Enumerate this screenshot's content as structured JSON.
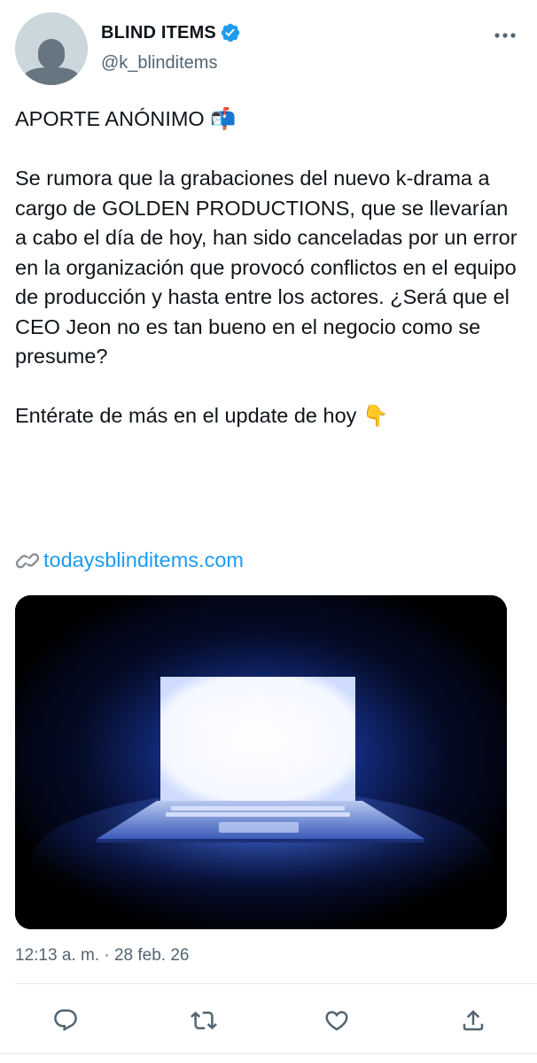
{
  "author": {
    "display_name": "BLIND ITEMS",
    "handle": "@k_blinditems",
    "verified": true
  },
  "tweet": {
    "heading": "APORTE ANÓNIMO 📬",
    "body": "Se rumora que la grabaciones del nuevo k-drama a cargo de GOLDEN PRODUCTIONS, que se llevarían a cabo el día de hoy, han sido canceladas por un error en la organización que provocó conflictos en el equipo de producción y hasta entre los actores. ¿Será que el CEO Jeon no es tan bueno en el negocio como se presume?",
    "cta": "Entérate de más en el update de hoy 👇",
    "link_emoji": "🔗",
    "link_text": "todaysblinditems.com",
    "timestamp": "12:13 a. m. · 28 feb. 26"
  },
  "colors": {
    "accent": "#1d9bf0",
    "secondary_text": "#536471",
    "primary_text": "#0f1419"
  },
  "icons": {
    "more": "more-horizontal-icon",
    "reply": "reply-icon",
    "retweet": "retweet-icon",
    "like": "heart-icon",
    "share": "share-icon"
  }
}
